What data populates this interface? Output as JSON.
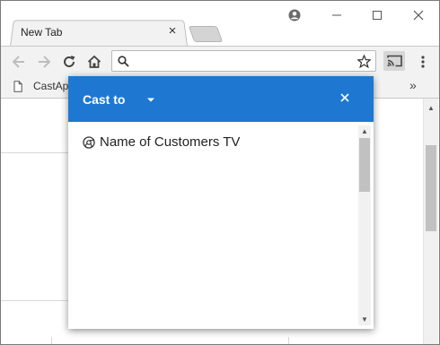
{
  "tab": {
    "title": "New Tab",
    "close_glyph": "×"
  },
  "window_controls": {
    "minimize_glyph": "—",
    "maximize_glyph": "☐",
    "close_glyph": "✕"
  },
  "toolbar": {
    "address_value": "",
    "icons": [
      "back-icon",
      "forward-icon",
      "reload-icon",
      "home-icon",
      "search-icon",
      "star-icon",
      "cast-icon",
      "menu-icon"
    ]
  },
  "bookmarks": {
    "items": [
      {
        "label": "CastAp",
        "icon": "page-icon"
      }
    ],
    "more_glyph": "»"
  },
  "cast_dialog": {
    "title": "Cast to",
    "close_glyph": "✕",
    "sinks": [
      {
        "name": "Name of Customers TV",
        "icon": "chrome-cast-sink-icon"
      }
    ],
    "accent_color": "#1e78d2"
  }
}
